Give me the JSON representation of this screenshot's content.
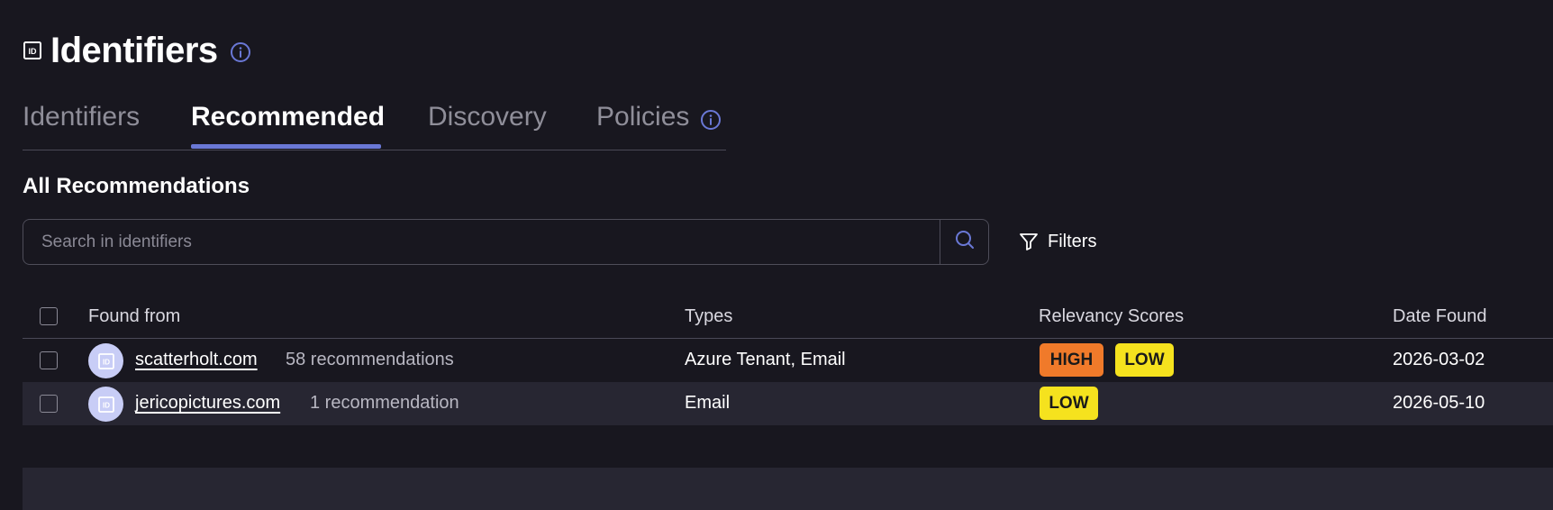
{
  "header": {
    "title": "Identifiers",
    "icon": "id-card-icon",
    "info_icon": "info-icon"
  },
  "tabs": [
    {
      "label": "Identifiers",
      "active": false
    },
    {
      "label": "Recommended",
      "active": true
    },
    {
      "label": "Discovery",
      "active": false
    },
    {
      "label": "Policies",
      "active": false,
      "has_info_icon": true
    }
  ],
  "section": {
    "title": "All Recommendations"
  },
  "search": {
    "placeholder": "Search in identifiers",
    "value": ""
  },
  "filters": {
    "label": "Filters"
  },
  "table": {
    "columns": [
      "Found from",
      "Types",
      "Relevancy Scores",
      "Date Found"
    ],
    "rows": [
      {
        "domain": "scatterholt.com",
        "count": "58 recommendations",
        "types": "Azure Tenant, Email",
        "scores": [
          "HIGH",
          "LOW"
        ],
        "date": "2026-03-02"
      },
      {
        "domain": "jericopictures.com",
        "count": "1 recommendation",
        "types": "Email",
        "scores": [
          "LOW"
        ],
        "date": "2026-05-10"
      }
    ]
  },
  "colors": {
    "background": "#18171f",
    "accent": "#6a78d6",
    "high": "#f07a2a",
    "low": "#f5e21e",
    "row_alt": "#272632"
  }
}
